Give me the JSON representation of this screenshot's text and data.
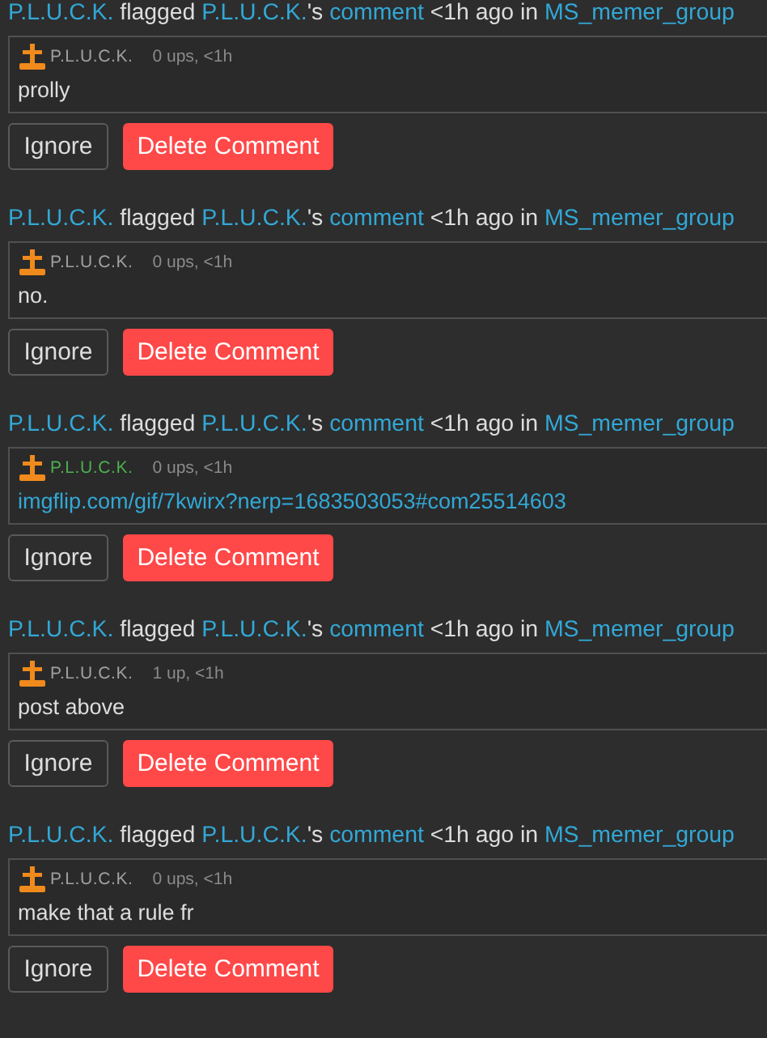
{
  "reports": [
    {
      "flagger": "P.L.U.C.K.",
      "verb": "flagged",
      "target": "P.L.U.C.K.",
      "possessive": "'s",
      "object": "comment",
      "when": "<1h ago in",
      "group": "MS_memer_group",
      "comment": {
        "author": "P.L.U.C.K.",
        "color": "#a0a0a0",
        "meta": "0 ups, <1h",
        "kind": "text",
        "body": "prolly"
      },
      "buttons": [
        "Ignore",
        "Delete Comment"
      ]
    },
    {
      "flagger": "P.L.U.C.K.",
      "verb": "flagged",
      "target": "P.L.U.C.K.",
      "possessive": "'s",
      "object": "comment",
      "when": "<1h ago in",
      "group": "MS_memer_group",
      "comment": {
        "author": "P.L.U.C.K.",
        "color": "#a0a0a0",
        "meta": "0 ups, <1h",
        "kind": "text",
        "body": "no."
      },
      "buttons": [
        "Ignore",
        "Delete Comment"
      ]
    },
    {
      "flagger": "P.L.U.C.K.",
      "verb": "flagged",
      "target": "P.L.U.C.K.",
      "possessive": "'s",
      "object": "comment",
      "when": "<1h ago in",
      "group": "MS_memer_group",
      "comment": {
        "author": "P.L.U.C.K.",
        "color": "#4caf50",
        "meta": "0 ups, <1h",
        "kind": "link",
        "body": "imgflip.com/gif/7kwirx?nerp=1683503053#com25514603"
      },
      "buttons": [
        "Ignore",
        "Delete Comment"
      ]
    },
    {
      "flagger": "P.L.U.C.K.",
      "verb": "flagged",
      "target": "P.L.U.C.K.",
      "possessive": "'s",
      "object": "comment",
      "when": "<1h ago in",
      "group": "MS_memer_group",
      "comment": {
        "author": "P.L.U.C.K.",
        "color": "#a0a0a0",
        "meta": "1 up, <1h",
        "kind": "text",
        "body": "post above"
      },
      "buttons": [
        "Ignore",
        "Delete Comment"
      ]
    },
    {
      "flagger": "P.L.U.C.K.",
      "verb": "flagged",
      "target": "P.L.U.C.K.",
      "possessive": "'s",
      "object": "comment",
      "when": "<1h ago in",
      "group": "MS_memer_group",
      "comment": {
        "author": "P.L.U.C.K.",
        "color": "#a0a0a0",
        "meta": "0 ups, <1h",
        "kind": "text",
        "body": "make that a rule fr"
      },
      "buttons": [
        "Ignore",
        "Delete Comment"
      ]
    }
  ]
}
